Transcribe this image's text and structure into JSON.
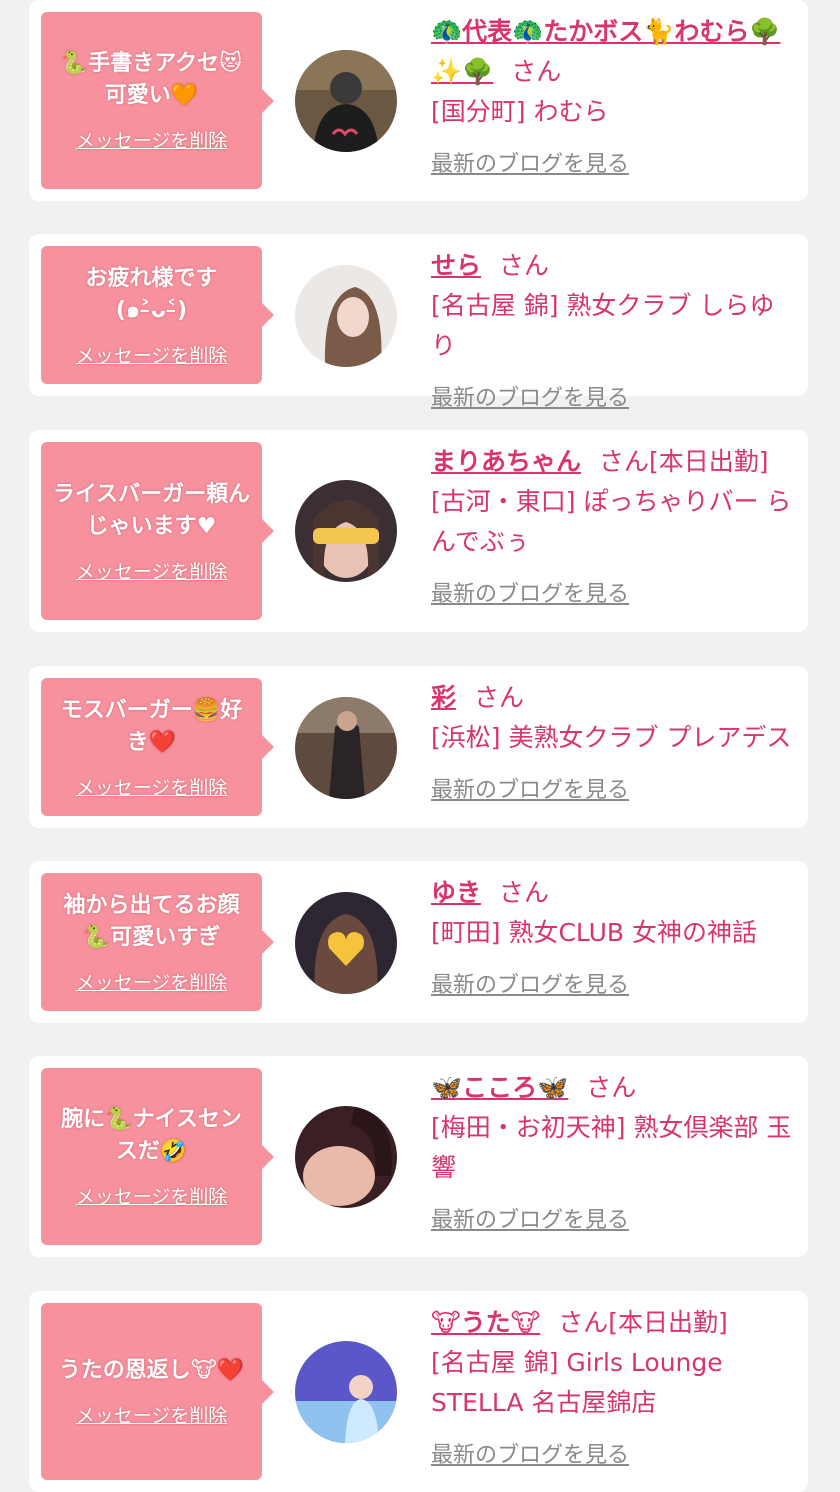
{
  "colors": {
    "background": "#f1f1f1",
    "card": "#ffffff",
    "bubble": "#f7919e",
    "name_text": "#d9346d",
    "blog_link": "#8a8a8a"
  },
  "delete_label": "メッセージを削除",
  "blog_label": "最新のブログを見る",
  "san_label": "さん",
  "entries": [
    {
      "message": "🐍手書きアクセ😻可愛い🧡",
      "name": "🦚代表🦚たかボス🐈わむら🌳✨🌳",
      "suffix": "",
      "shop": "[国分町] わむら",
      "avatar_icon": "avatar-photo-icon"
    },
    {
      "message": "お疲れ様です(๑˃̵ᴗ˂̵)",
      "name": "せら",
      "suffix": "",
      "shop": "[名古屋 錦] 熟女クラブ しらゆり",
      "avatar_icon": "avatar-photo-icon"
    },
    {
      "message": "ライスバーガー頼んじゃいます♥",
      "name": "まりあちゃん",
      "suffix": "[本日出勤]",
      "shop": "[古河・東口] ぽっちゃりバー らんでぶぅ",
      "avatar_icon": "avatar-photo-icon"
    },
    {
      "message": "モスバーガー🍔好き❤️",
      "name": "彩",
      "suffix": "",
      "shop": "[浜松] 美熟女クラブ プレアデス",
      "avatar_icon": "avatar-photo-icon"
    },
    {
      "message": "袖から出てるお顔🐍可愛いすぎ",
      "name": "ゆき",
      "suffix": "",
      "shop": "[町田] 熟女CLUB 女神の神話",
      "avatar_icon": "avatar-photo-icon"
    },
    {
      "message": "腕に🐍ナイスセンスだ🤣",
      "name": "🦋こころ🦋",
      "suffix": "",
      "shop": "[梅田・お初天神] 熟女倶楽部 玉響",
      "avatar_icon": "avatar-photo-icon"
    },
    {
      "message": "うたの恩返し🐮❤️",
      "name": "🐮うた🐮",
      "suffix": "[本日出勤]",
      "shop": "[名古屋 錦] Girls Lounge STELLA 名古屋錦店",
      "avatar_icon": "avatar-photo-icon"
    }
  ]
}
